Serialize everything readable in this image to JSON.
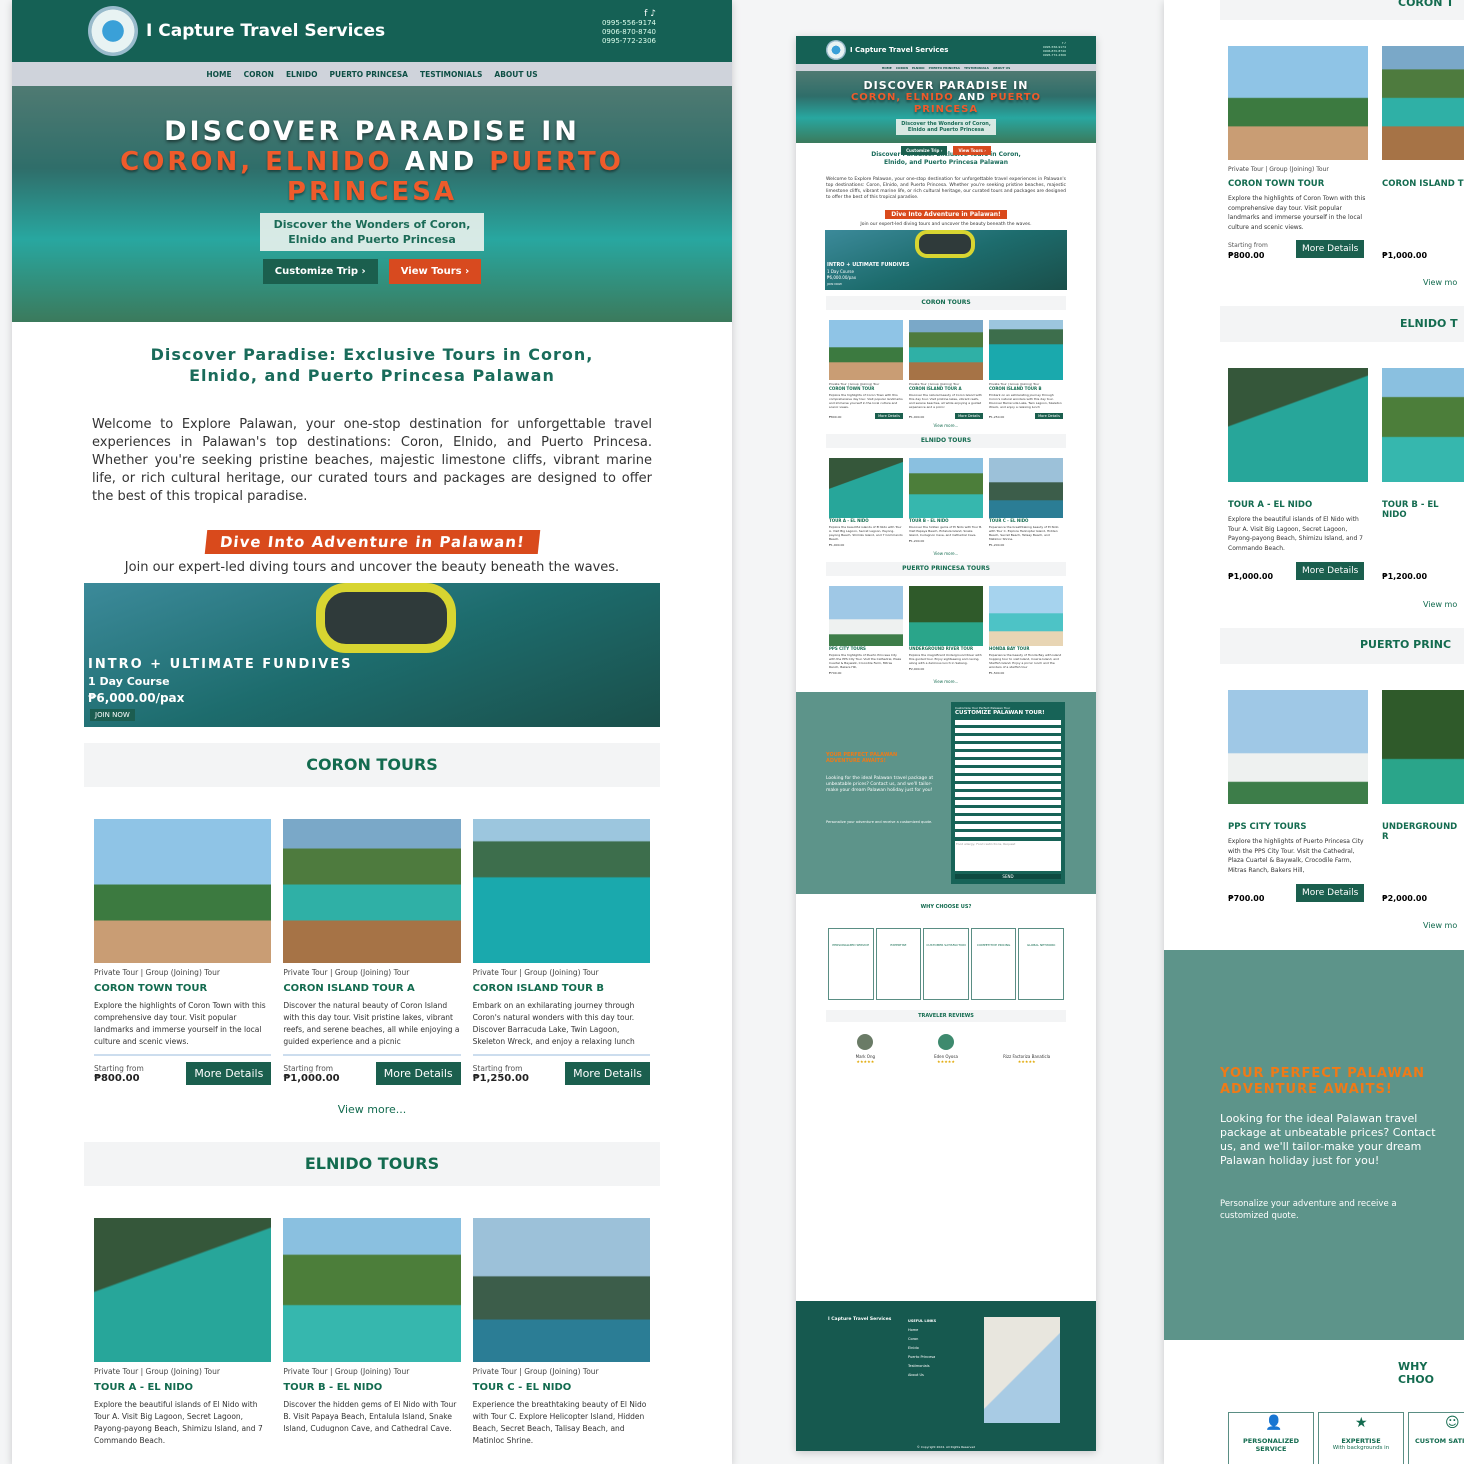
{
  "site": {
    "brand": "I Capture Travel Services",
    "phones": [
      "0995-556-9174",
      "0906-870-8740",
      "0995-772-2306"
    ],
    "social": "f ♪",
    "nav": [
      "HOME",
      "CORON",
      "ELNIDO",
      "PUERTO PRINCESA",
      "TESTIMONIALS",
      "ABOUT US"
    ]
  },
  "hero": {
    "line1": "DISCOVER PARADISE IN",
    "coron": "CORON,",
    "elnido": "ELNIDO",
    "and": "AND",
    "puerto": "PUERTO",
    "princesa": "PRINCESA",
    "subtitle1": "Discover the Wonders of Coron,",
    "subtitle2": "Elnido and Puerto Princesa",
    "btn_customize": "Customize Trip ›",
    "btn_view": "View Tours ›"
  },
  "intro": {
    "heading1": "Discover Paradise: Exclusive Tours in Coron,",
    "heading2": "Elnido, and Puerto Princesa Palawan",
    "body": "Welcome to Explore Palawan, your one-stop destination for unforgettable travel experiences in Palawan's top destinations: Coron, Elnido, and Puerto Princesa. Whether you're seeking pristine beaches, majestic limestone cliffs, vibrant marine life, or rich cultural heritage, our curated tours and packages are designed to offer the best of this tropical paradise."
  },
  "dive": {
    "ribbon": "Dive Into Adventure in Palawan!",
    "sub": "Join our expert-led diving tours and uncover the beauty beneath the waves.",
    "title": "INTRO + ULTIMATE FUNDIVES",
    "course": "1 Day Course",
    "price": "₱6,000.00/pax",
    "cta": "JOIN NOW"
  },
  "coron": {
    "title": "CORON TOURS",
    "cards": [
      {
        "meta": "Private Tour | Group (Joining) Tour",
        "name": "CORON TOWN TOUR",
        "desc": "Explore the highlights of Coron Town with this comprehensive day tour. Visit popular landmarks and immerse yourself in the local culture and scenic views.",
        "from": "Starting from",
        "price": "₱800.00",
        "btn": "More Details"
      },
      {
        "meta": "Private Tour | Group (Joining) Tour",
        "name": "CORON ISLAND TOUR A",
        "desc": "Discover the natural beauty of Coron Island with this day tour. Visit pristine lakes, vibrant reefs, and serene beaches, all while enjoying a guided experience and a picnic",
        "from": "Starting from",
        "price": "₱1,000.00",
        "btn": "More Details"
      },
      {
        "meta": "Private Tour | Group (Joining) Tour",
        "name": "CORON ISLAND TOUR B",
        "desc": "Embark on an exhilarating journey through Coron's natural wonders with this day tour. Discover Barracuda Lake, Twin Lagoon, Skeleton Wreck, and enjoy a relaxing lunch",
        "from": "Starting from",
        "price": "₱1,250.00",
        "btn": "More Details"
      }
    ],
    "view_more": "View more..."
  },
  "elnido": {
    "title": "ELNIDO TOURS",
    "cards": [
      {
        "meta": "Private Tour | Group (Joining) Tour",
        "name": "TOUR A - EL NIDO",
        "desc": "Explore the beautiful islands of El Nido with Tour A. Visit Big Lagoon, Secret Lagoon, Payong-payong Beach, Shimizu Island, and 7 Commando Beach.",
        "price": "₱1,000.00"
      },
      {
        "meta": "Private Tour | Group (Joining) Tour",
        "name": "TOUR B - EL NIDO",
        "desc": "Discover the hidden gems of El Nido with Tour B. Visit Papaya Beach, Entalula Island, Snake Island, Cudugnon Cave, and Cathedral Cave.",
        "price": "₱1,200.00"
      },
      {
        "meta": "Private Tour | Group (Joining) Tour",
        "name": "TOUR C - EL NIDO",
        "desc": "Experience the breathtaking beauty of El Nido with Tour C. Explore Helicopter Island, Hidden Beach, Secret Beach, Talisay Beach, and Matinloc Shrine.",
        "price": "₱1,200.00"
      }
    ],
    "view_more": "View more..."
  },
  "puerto": {
    "title": "PUERTO PRINCESA TOURS",
    "cards": [
      {
        "meta": "Private Tour | Group (Joining) Tour",
        "name": "PPS CITY TOURS",
        "desc": "Explore the highlights of Puerto Princesa City with the PPS City Tour. Visit the Cathedral, Plaza Cuartel & Baywalk, Crocodile Farm, Mitras Ranch, Bakers Hill,",
        "price": "₱700.00"
      },
      {
        "meta": "Private Tour | Group (Joining) Tour",
        "name": "UNDERGROUND RIVER TOUR",
        "desc": "Explore the magnificent Underground River with this guided tour. Enjoy sightseeing and caving, along with a delicious lunch in Sabang.",
        "price": "₱2,000.00"
      },
      {
        "meta": "Private Tour | Group (Joining) Tour",
        "name": "HONDA BAY TOUR",
        "desc": "Experience the beauty of Honda Bay with island hopping tour to visit Island, Cowrie Island, and Starfish Island. Enjoy a picnic lunch and the wonders of a starfish tour",
        "price": "₱1,500.00"
      }
    ]
  },
  "customize": {
    "kicker": "Customize Your Perfect Palawan Tour",
    "form_title": "CUSTOMIZE PALAWAN TOUR!",
    "headline1": "YOUR PERFECT PALAWAN",
    "headline2": "ADVENTURE AWAITS!",
    "body": "Looking for the ideal Palawan travel package at unbeatable prices? Contact us, and we'll tailor-make your dream Palawan holiday just for you!",
    "body2": "Personalize your adventure and receive a customized quote.",
    "send": "SEND",
    "remarks_placeholder": "Food allergy, Food restrictions, Request"
  },
  "why": {
    "title": "WHY CHOOSE US?",
    "items": [
      "PERSONALIZED SERVICE",
      "EXPERTISE",
      "CUSTOMER SATISFACTION",
      "COMPETITIVE PRICING",
      "GLOBAL NETWORK"
    ]
  },
  "reviews": {
    "title": "TRAVELER REVIEWS",
    "names": [
      "Mark Ong",
      "Eden Oyosa",
      "Rizz Factoriza Banaticla"
    ],
    "stars": "★★★★★"
  },
  "footer": {
    "brand": "I Capture Travel Services",
    "links_title": "USEFUL LINKS",
    "links": [
      "Home",
      "Coron",
      "Elnido",
      "Puerto Princesa",
      "Testimonials",
      "About Us"
    ],
    "reservation": "Contact for reservation",
    "copyright": "© Copyright 2024. All Rights Reserved"
  },
  "right_panel": {
    "coron_partial": "CORON T",
    "elnido_partial": "ELNIDO T",
    "puerto_partial": "PUERTO PRINC",
    "why_partial": "WHY CHOO",
    "card2_coron": "CORON ISLAND T",
    "card2_elnido": "TOUR B - EL NIDO",
    "card2_puerto": "UNDERGROUND R",
    "view_more": "View mo",
    "why1": "PERSONALIZED SERVICE",
    "why2": "EXPERTISE",
    "why2_sub": "With backgrounds in",
    "why3": "CUSTOM SATISFACT"
  }
}
